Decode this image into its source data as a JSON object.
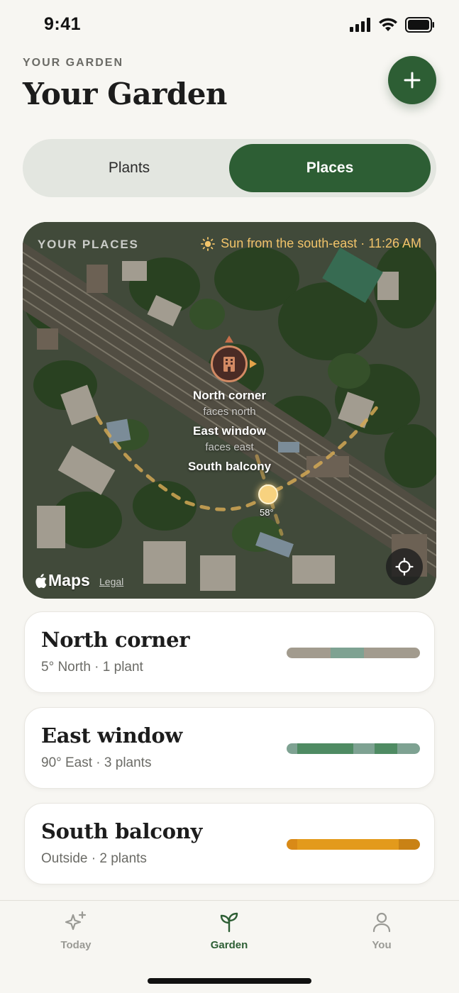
{
  "status_bar": {
    "time": "9:41"
  },
  "header": {
    "eyebrow": "YOUR GARDEN",
    "title": "Your Garden"
  },
  "segmented": {
    "options": [
      "Plants",
      "Places"
    ],
    "selected": "Places"
  },
  "map": {
    "eyebrow": "YOUR PLACES",
    "sun_note": "Sun from the south-east · 11:26 AM",
    "labels": [
      {
        "name": "North corner",
        "sub": "faces north"
      },
      {
        "name": "East window",
        "sub": "faces east"
      },
      {
        "name": "South balcony",
        "sub": ""
      }
    ],
    "sun_angle": "58°",
    "logo": "Maps",
    "legal": "Legal"
  },
  "places": [
    {
      "name": "North corner",
      "meta": "5° North · 1 plant",
      "bar": [
        [
          "#a29b8e",
          0.33
        ],
        [
          "#7ea292",
          0.25
        ],
        [
          "#a29b8e",
          0.42
        ]
      ]
    },
    {
      "name": "East window",
      "meta": "90° East · 3 plants",
      "bar": [
        [
          "#7ea292",
          0.08
        ],
        [
          "#4f8b63",
          0.42
        ],
        [
          "#7ea292",
          0.16
        ],
        [
          "#4f8b63",
          0.17
        ],
        [
          "#7ea292",
          0.17
        ]
      ]
    },
    {
      "name": "South balcony",
      "meta": "Outside · 2 plants",
      "bar": [
        [
          "#d98a17",
          0.08
        ],
        [
          "#e39a1c",
          0.76
        ],
        [
          "#c98215",
          0.16
        ]
      ]
    }
  ],
  "tabs": [
    {
      "label": "Today",
      "icon": "sparkles-icon"
    },
    {
      "label": "Garden",
      "icon": "sprout-icon",
      "active": true
    },
    {
      "label": "You",
      "icon": "person-icon"
    }
  ],
  "colors": {
    "brand_green": "#2d5e34",
    "sun_gold": "#f2c46a",
    "background": "#f7f6f2"
  }
}
